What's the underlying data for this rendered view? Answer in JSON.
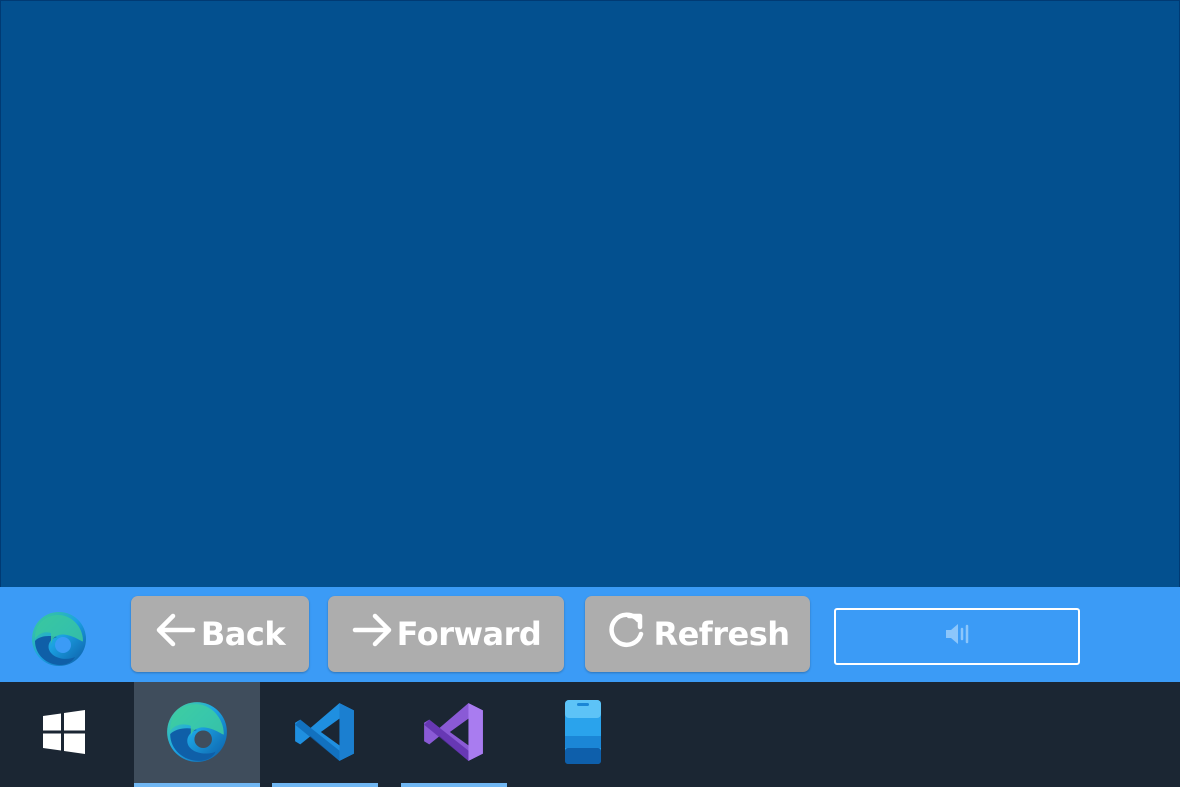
{
  "toolbar": {
    "app_icon": "edge-logo-icon",
    "back_label": "Back",
    "back_icon": "arrow-left-icon",
    "forward_label": "Forward",
    "forward_icon": "arrow-right-icon",
    "refresh_label": "Refresh",
    "refresh_icon": "refresh-icon",
    "volume_icon": "speaker-icon"
  },
  "taskbar": {
    "start_icon": "windows-start-icon",
    "apps": [
      {
        "icon": "edge-icon",
        "active": true,
        "running": true
      },
      {
        "icon": "vscode-icon",
        "active": false,
        "running": true
      },
      {
        "icon": "visual-studio-icon",
        "active": false,
        "running": true
      },
      {
        "icon": "phone-app-icon",
        "active": false,
        "running": false
      }
    ]
  },
  "colors": {
    "content_background": "#03508f",
    "toolbar_background": "#3b9bf6",
    "button_background": "#adadad",
    "taskbar_background": "#1b2633",
    "taskbar_active": "#3f4d5c",
    "taskbar_indicator": "#70b6f2"
  }
}
